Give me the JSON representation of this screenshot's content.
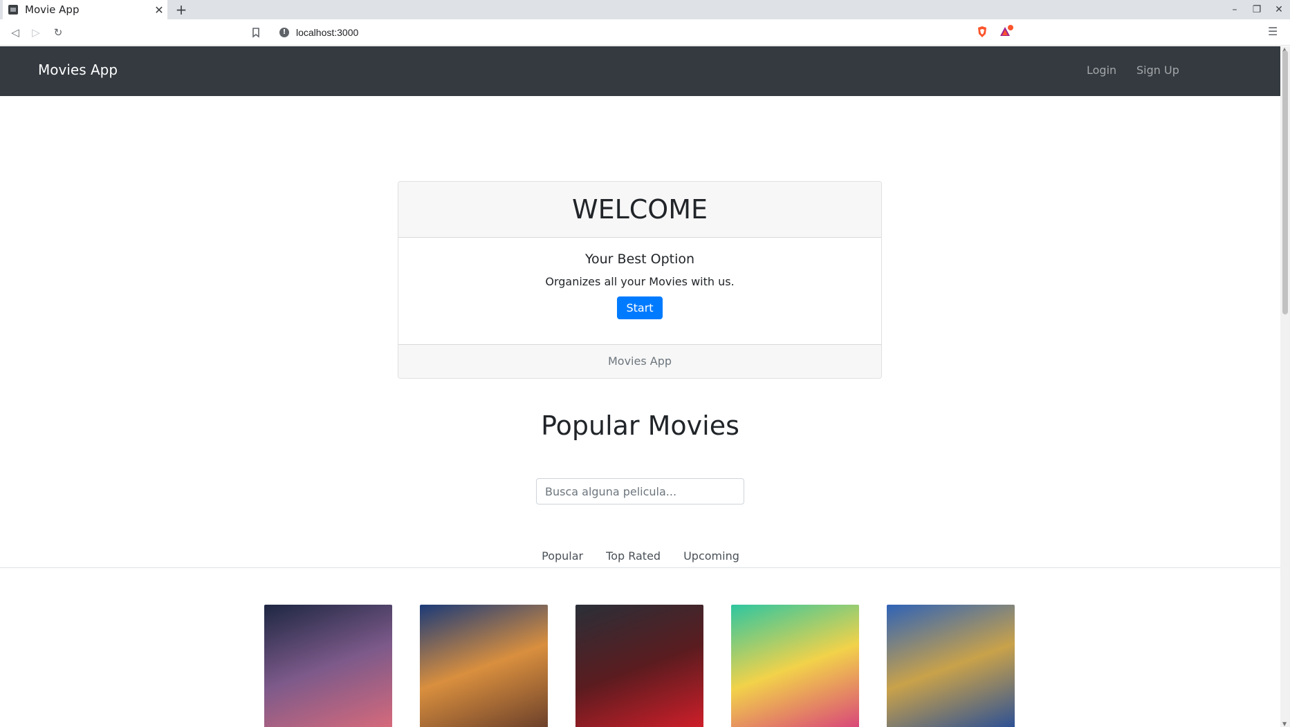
{
  "browser": {
    "tab_title": "Movie App",
    "tab_close": "✕",
    "new_tab": "+",
    "url": "localhost:3000",
    "win_minimize": "–",
    "win_restore": "❐",
    "win_close": "✕",
    "menu_glyph": "☰",
    "back_glyph": "◁",
    "forward_glyph": "▷",
    "reload_glyph": "↻",
    "info_glyph": "!"
  },
  "navbar": {
    "brand": "Movies App",
    "login": "Login",
    "signup": "Sign Up"
  },
  "welcome_card": {
    "header": "WELCOME",
    "title": "Your Best Option",
    "text": "Organizes all your Movies with us.",
    "button": "Start",
    "footer": "Movies App"
  },
  "section": {
    "title": "Popular Movies"
  },
  "search": {
    "placeholder": "Busca alguna pelicula...",
    "value": ""
  },
  "tabs": [
    {
      "label": "Popular"
    },
    {
      "label": "Top Rated"
    },
    {
      "label": "Upcoming"
    }
  ],
  "posters": [
    {
      "name": "ad-astra-poster",
      "colors": [
        "#1d2742",
        "#7d5a8a",
        "#d86a7b"
      ]
    },
    {
      "name": "scoob-poster",
      "colors": [
        "#1b3a78",
        "#d98f3e",
        "#6a3f2a"
      ]
    },
    {
      "name": "bloodshot-poster",
      "colors": [
        "#2a2f38",
        "#5a1c1f",
        "#d11e2a"
      ]
    },
    {
      "name": "birds-of-prey-poster",
      "colors": [
        "#2ec6a0",
        "#f2d24a",
        "#d8447a"
      ]
    },
    {
      "name": "sonic-poster",
      "colors": [
        "#2f63b7",
        "#c9a24a",
        "#2a4f96"
      ]
    }
  ],
  "colors": {
    "navbar_bg": "#343a40",
    "primary": "#007bff"
  }
}
